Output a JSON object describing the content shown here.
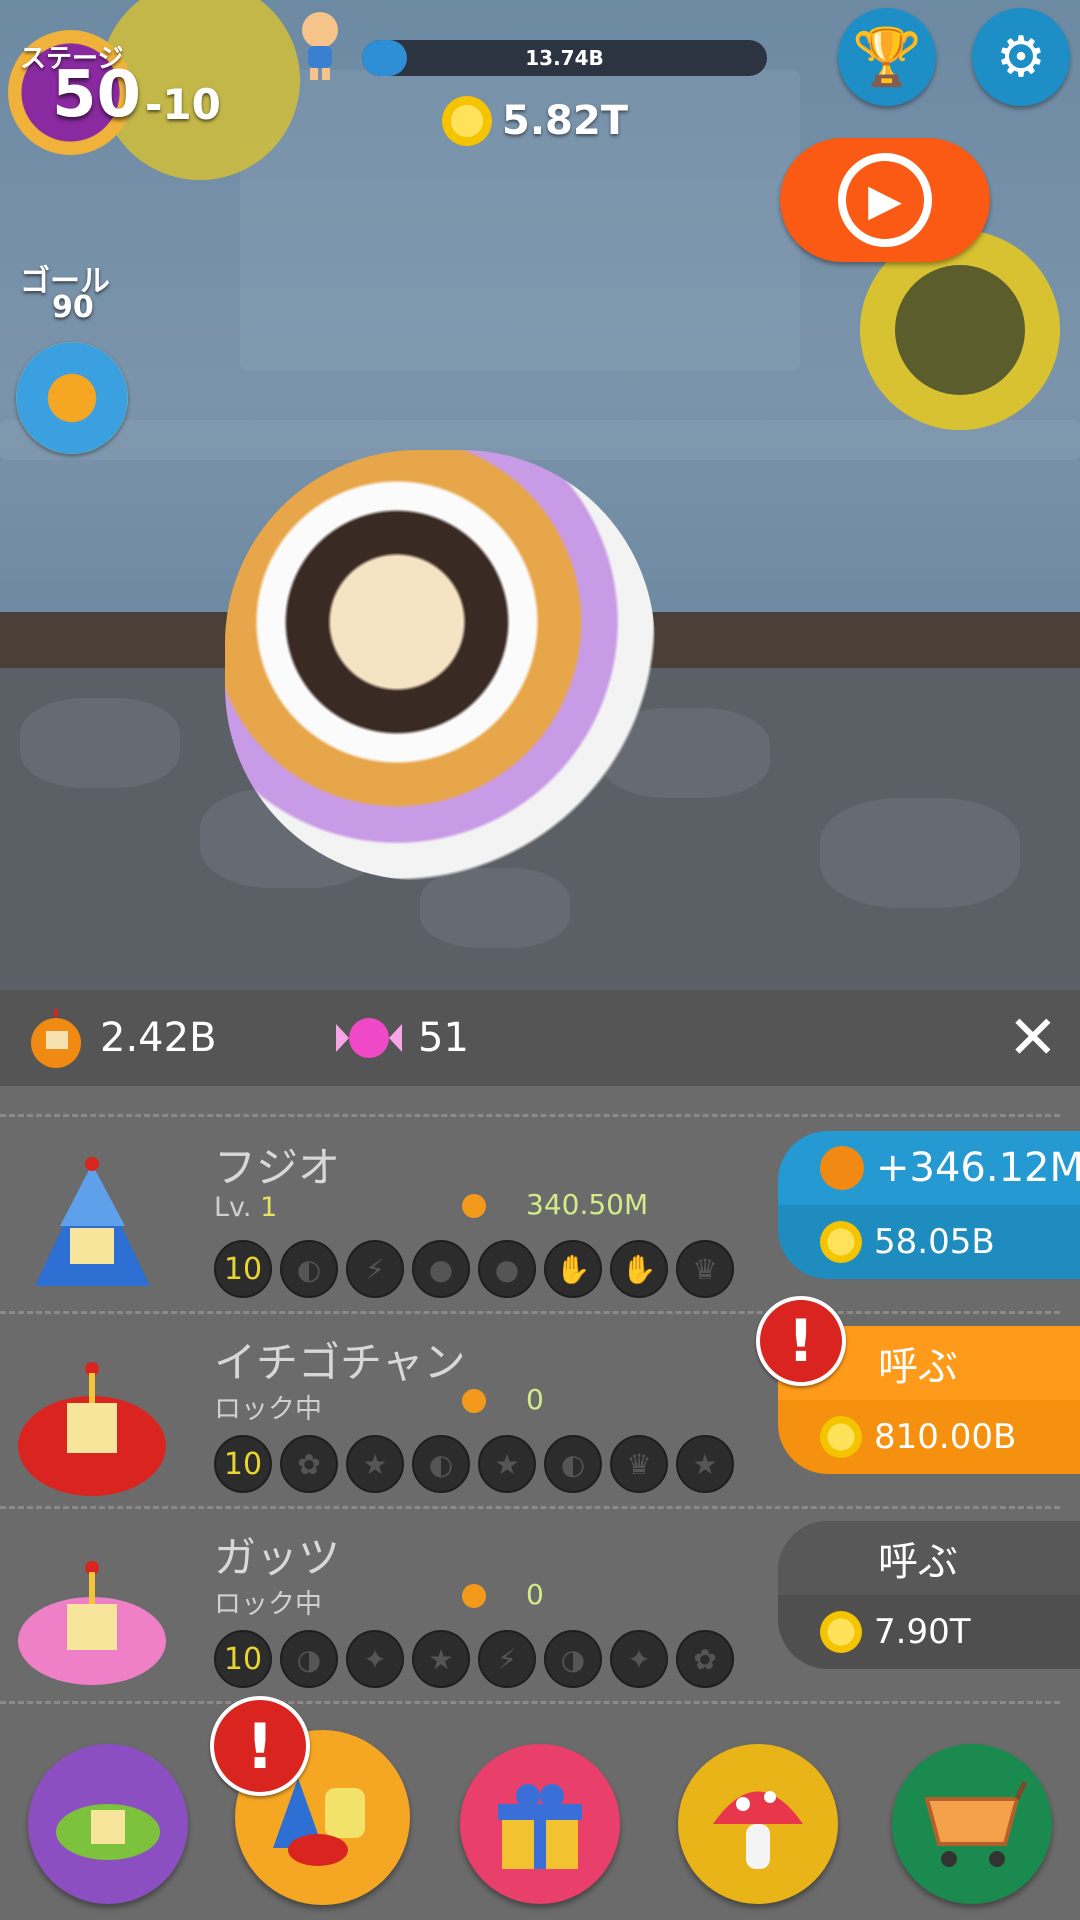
{
  "hud": {
    "stage_label": "ステージ",
    "stage_number": "50",
    "stage_sub": "-10",
    "goal_label": "ゴール",
    "goal_number": "90",
    "size_value": "13.74B",
    "size_progress": 0.11,
    "coins": "5.82T"
  },
  "icons": {
    "trophy": "trophy-icon",
    "settings": "gear-icon",
    "video": "alarm-play-icon"
  },
  "currency": {
    "bomb_amount": "2.42B",
    "candy_amount": "51"
  },
  "characters": [
    {
      "name": "フジオ",
      "level_label": "Lv.",
      "level_value": "1",
      "power": "340.50M",
      "skill_level": "10",
      "button_top": "+346.12M",
      "button_cost": "58.05B",
      "button_color": "#1f8cc0"
    },
    {
      "name": "イチゴチャン",
      "level_label": "ロック中",
      "level_value": "",
      "power": "0",
      "skill_level": "10",
      "button_top": "呼ぶ",
      "button_cost": "810.00B",
      "button_color": "#f5910f"
    },
    {
      "name": "ガッツ",
      "level_label": "ロック中",
      "level_value": "",
      "power": "0",
      "skill_level": "10",
      "button_top": "呼ぶ",
      "button_cost": "7.90T",
      "button_color": "#565656"
    }
  ],
  "colors": {
    "accent_blue": "#1d8ec6",
    "accent_orange": "#fa5a14",
    "alert_red": "#d9241f",
    "coin_gold": "#f5c400"
  }
}
